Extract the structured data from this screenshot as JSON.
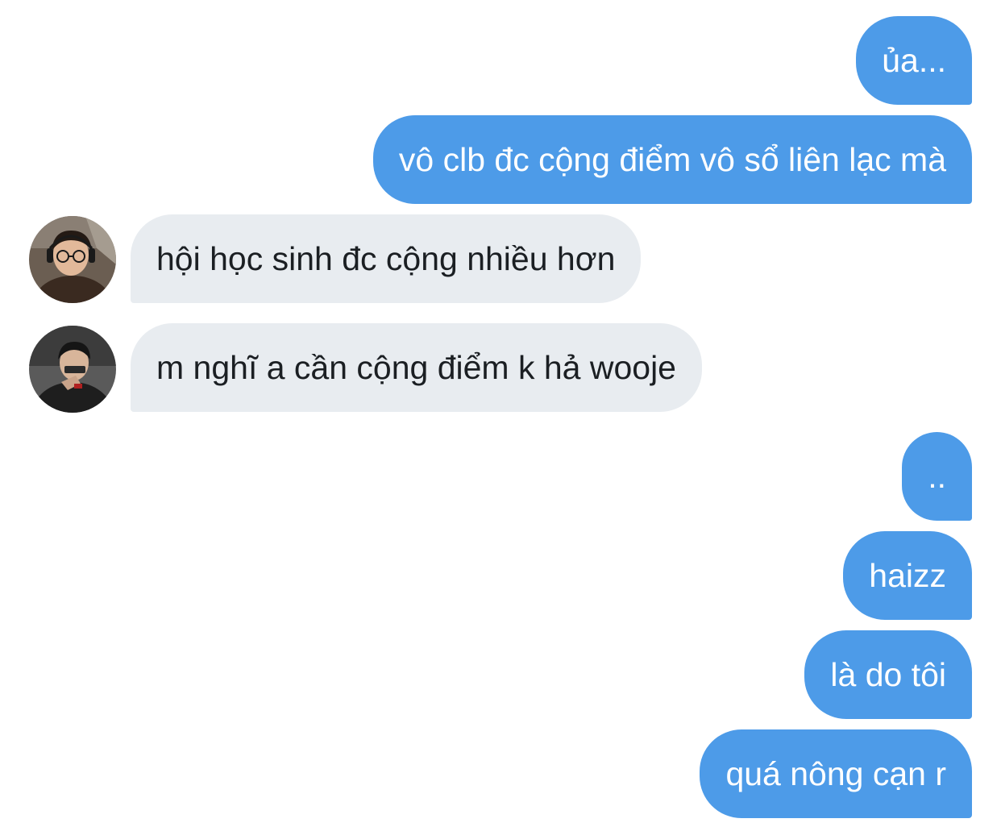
{
  "messages": [
    {
      "direction": "outgoing",
      "text": "ủa..."
    },
    {
      "direction": "outgoing",
      "text": "vô clb đc cộng điểm vô sổ liên lạc mà"
    },
    {
      "direction": "incoming",
      "text": "hội học sinh đc cộng nhiều hơn",
      "avatar": "avatar-photo-glasses"
    },
    {
      "direction": "incoming",
      "text": "m nghĩ a cần cộng điểm k hả wooje",
      "avatar": "avatar-photo-dark"
    },
    {
      "direction": "outgoing",
      "text": ".."
    },
    {
      "direction": "outgoing",
      "text": "haizz"
    },
    {
      "direction": "outgoing",
      "text": "là do tôi"
    },
    {
      "direction": "outgoing",
      "text": "quá nông cạn r"
    }
  ],
  "colors": {
    "outgoing_bubble": "#4d9be8",
    "incoming_bubble": "#e8ecf0",
    "outgoing_text": "#ffffff",
    "incoming_text": "#1b1f23",
    "background": "#ffffff"
  }
}
